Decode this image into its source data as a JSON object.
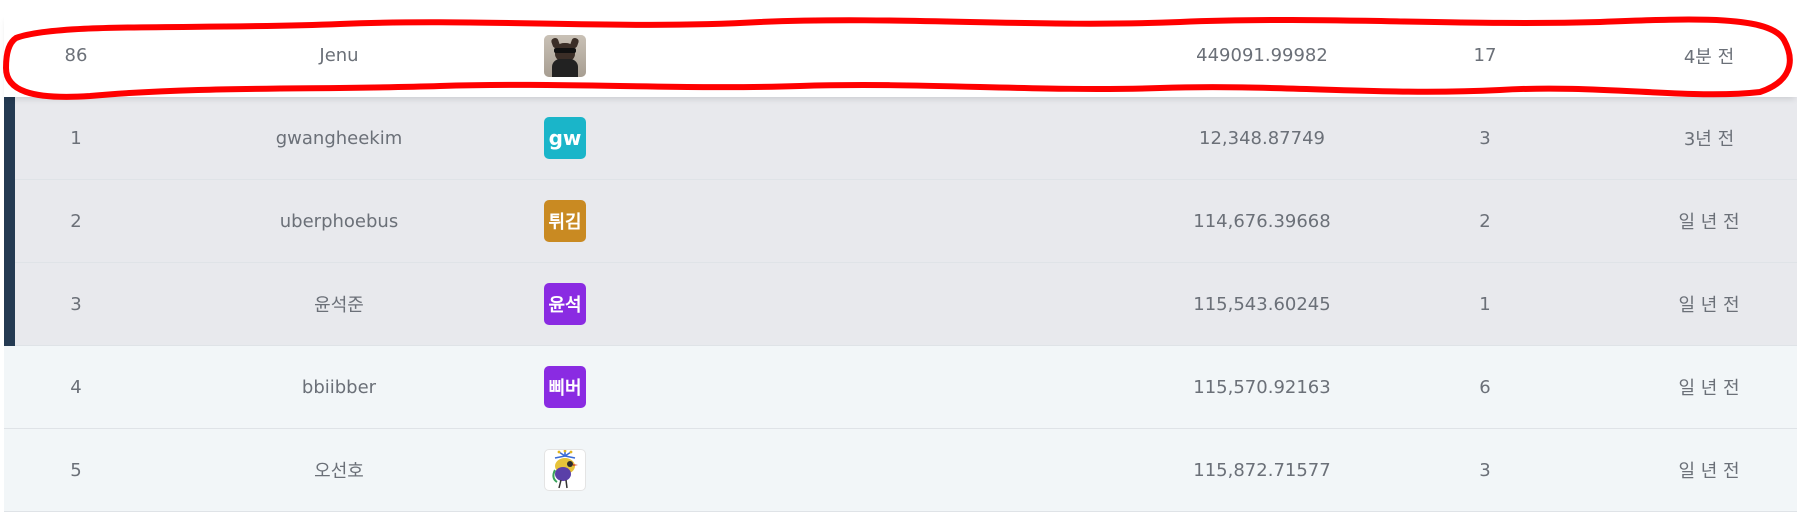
{
  "current_user": {
    "rank": "86",
    "name": "Jenu",
    "avatar_icon": "dog-with-sunglasses-photo",
    "score": "449091.99982",
    "submissions": "17",
    "last_submitted": "4분 전"
  },
  "rows": [
    {
      "rank": "1",
      "name": "gwangheekim",
      "avatar_text": "gw",
      "avatar_color": "#1ab5c9",
      "score": "12,348.87749",
      "submissions": "3",
      "last_submitted": "3년 전"
    },
    {
      "rank": "2",
      "name": "uberphoebus",
      "avatar_text": "튀김",
      "avatar_color": "#c98a22",
      "score": "114,676.39668",
      "submissions": "2",
      "last_submitted": "일 년 전"
    },
    {
      "rank": "3",
      "name": "윤석준",
      "avatar_text": "윤석",
      "avatar_color": "#8a2be2",
      "score": "115,543.60245",
      "submissions": "1",
      "last_submitted": "일 년 전"
    },
    {
      "rank": "4",
      "name": "bbiibber",
      "avatar_text": "삐버",
      "avatar_color": "#8a2be2",
      "score": "115,570.92163",
      "submissions": "6",
      "last_submitted": "일 년 전"
    },
    {
      "rank": "5",
      "name": "오선호",
      "avatar_icon": "peacock-illustration",
      "score": "115,872.71577",
      "submissions": "3",
      "last_submitted": "일 년 전"
    }
  ],
  "colors": {
    "top3_background": "#e8e9ed",
    "top3_marker": "#243a52",
    "rest_background": "#f2f6f8",
    "annotation": "#ff0000"
  }
}
